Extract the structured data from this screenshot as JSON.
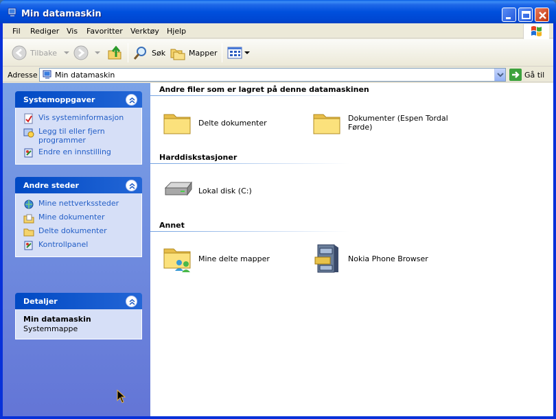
{
  "window": {
    "title": "Min datamaskin"
  },
  "menu": {
    "items": [
      "Fil",
      "Rediger",
      "Vis",
      "Favoritter",
      "Verktøy",
      "Hjelp"
    ]
  },
  "toolbar": {
    "back": "Tilbake",
    "search": "Søk",
    "folders": "Mapper"
  },
  "address": {
    "label": "Adresse",
    "value": "Min datamaskin",
    "go": "Gå til"
  },
  "taskpane": {
    "system": {
      "title": "Systemoppgaver",
      "items": [
        "Vis systeminformasjon",
        "Legg til eller fjern programmer",
        "Endre en innstilling"
      ]
    },
    "places": {
      "title": "Andre steder",
      "items": [
        "Mine nettverkssteder",
        "Mine dokumenter",
        "Delte dokumenter",
        "Kontrollpanel"
      ]
    },
    "details": {
      "title": "Detaljer",
      "name": "Min datamaskin",
      "type": "Systemmappe"
    }
  },
  "content": {
    "groups": [
      {
        "title": "Andre filer som er lagret på denne datamaskinen",
        "items": [
          "Delte dokumenter",
          "Dokumenter (Espen Tordal Førde)"
        ]
      },
      {
        "title": "Harddiskstasjoner",
        "items": [
          "Lokal disk (C:)"
        ]
      },
      {
        "title": "Annet",
        "items": [
          "Mine delte mapper",
          "Nokia Phone Browser"
        ]
      }
    ]
  },
  "colors": {
    "titlebar": "#0054e3",
    "link": "#215dc6",
    "taskpane": "#6b8ee0",
    "panel_head_dark": "#0049c4"
  }
}
